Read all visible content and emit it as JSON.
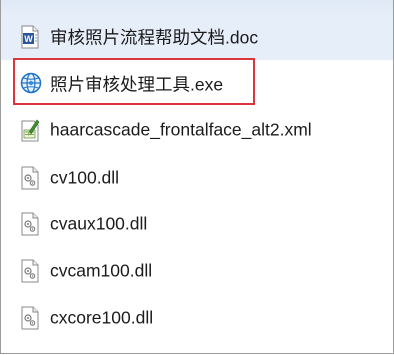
{
  "files": [
    {
      "name": "审核照片流程帮助文档.doc",
      "type": "word-document-icon"
    },
    {
      "name": "照片审核处理工具.exe",
      "type": "executable-globe-icon"
    },
    {
      "name": "haarcascade_frontalface_alt2.xml",
      "type": "xml-file-icon"
    },
    {
      "name": "cv100.dll",
      "type": "dll-file-icon"
    },
    {
      "name": "cvaux100.dll",
      "type": "dll-file-icon"
    },
    {
      "name": "cvcam100.dll",
      "type": "dll-file-icon"
    },
    {
      "name": "cxcore100.dll",
      "type": "dll-file-icon"
    }
  ],
  "highlight": {
    "target": "照片审核处理工具.exe",
    "color": "#d9363e"
  },
  "colors": {
    "selected_row_bg": "#e6eef9",
    "word_blue": "#2b579a",
    "globe_blue": "#1e73c8"
  }
}
